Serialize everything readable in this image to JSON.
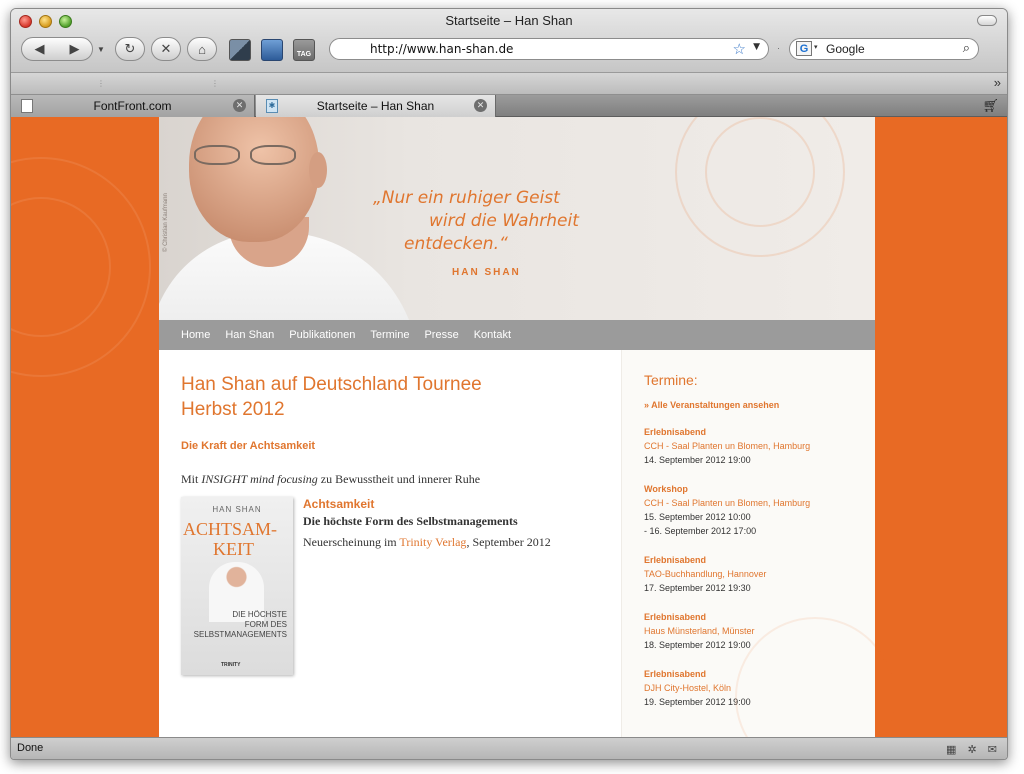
{
  "window": {
    "title": "Startseite – Han Shan"
  },
  "toolbar": {
    "back": "◀",
    "forward": "▶",
    "history": "▼",
    "reload": "↻",
    "stop": "✕",
    "home": "⌂",
    "tag_label": "TAG",
    "url": "http://www.han-shan.de",
    "star": "☆",
    "url_dropdown": "▼",
    "search_engine_letter": "G",
    "search_engine_dropdown": "▾",
    "search_placeholder": "Google",
    "search_icon": "⌕"
  },
  "bookmarks": {
    "more": "»"
  },
  "tabs": [
    {
      "label": "FontFront.com",
      "close": "✕"
    },
    {
      "label": "Startseite – Han Shan",
      "close": "✕"
    }
  ],
  "hero": {
    "quote_lines": [
      "„Nur ein ruhiger Geist",
      "wird die Wahrheit",
      "entdecken.“"
    ],
    "author": "HAN SHAN",
    "photo_credit": "© Christian Kaufmann"
  },
  "nav": [
    "Home",
    "Han Shan",
    "Publikationen",
    "Termine",
    "Presse",
    "Kontakt"
  ],
  "main": {
    "headline_line1": "Han Shan auf Deutschland Tournee",
    "headline_line2": "Herbst 2012",
    "subhead": "Die Kraft der Achtsamkeit",
    "intro_pre": "Mit ",
    "intro_em": "INSIGHT mind focusing",
    "intro_post": " zu Bewusstheit und innerer Ruhe",
    "book_cover": {
      "author": "HAN SHAN",
      "title_line1": "ACHTSAM-",
      "title_line2": "KEIT",
      "subtitle_line1": "DIE HÖCHSTE",
      "subtitle_line2": "FORM DES",
      "subtitle_line3": "SELBSTMANAGEMENTS",
      "publisher": "TRINITY"
    },
    "book_title": "Achtsamkeit",
    "book_subtitle": "Die höchste Form des Selbstmanagements",
    "book_release_pre": "Neuerscheinung im ",
    "book_publisher_link": "Trinity Verlag",
    "book_release_post": ", September 2012"
  },
  "sidebar": {
    "title": "Termine:",
    "all_link": "» Alle Veranstaltungen ansehen",
    "events": [
      {
        "type": "Erlebnisabend",
        "location": "CCH - Saal Planten un Blomen, Hamburg",
        "date1": "14. September 2012 19:00",
        "date2": ""
      },
      {
        "type": "Workshop",
        "location": "CCH - Saal Planten un Blomen, Hamburg",
        "date1": "15. September 2012 10:00",
        "date2": "- 16. September 2012 17:00"
      },
      {
        "type": "Erlebnisabend",
        "location": "TAO-Buchhandlung, Hannover",
        "date1": "17. September 2012 19:30",
        "date2": ""
      },
      {
        "type": "Erlebnisabend",
        "location": "Haus Münsterland, Münster",
        "date1": "18. September 2012 19:00",
        "date2": ""
      },
      {
        "type": "Erlebnisabend",
        "location": "DJH City-Hostel, Köln",
        "date1": "19. September 2012 19:00",
        "date2": ""
      }
    ]
  },
  "status": {
    "text": "Done",
    "icons": "▦ ✲ ✉"
  },
  "colors": {
    "accent": "#e86a24",
    "nav_grey": "#9b9b9b",
    "text_orange": "#e0762f"
  }
}
